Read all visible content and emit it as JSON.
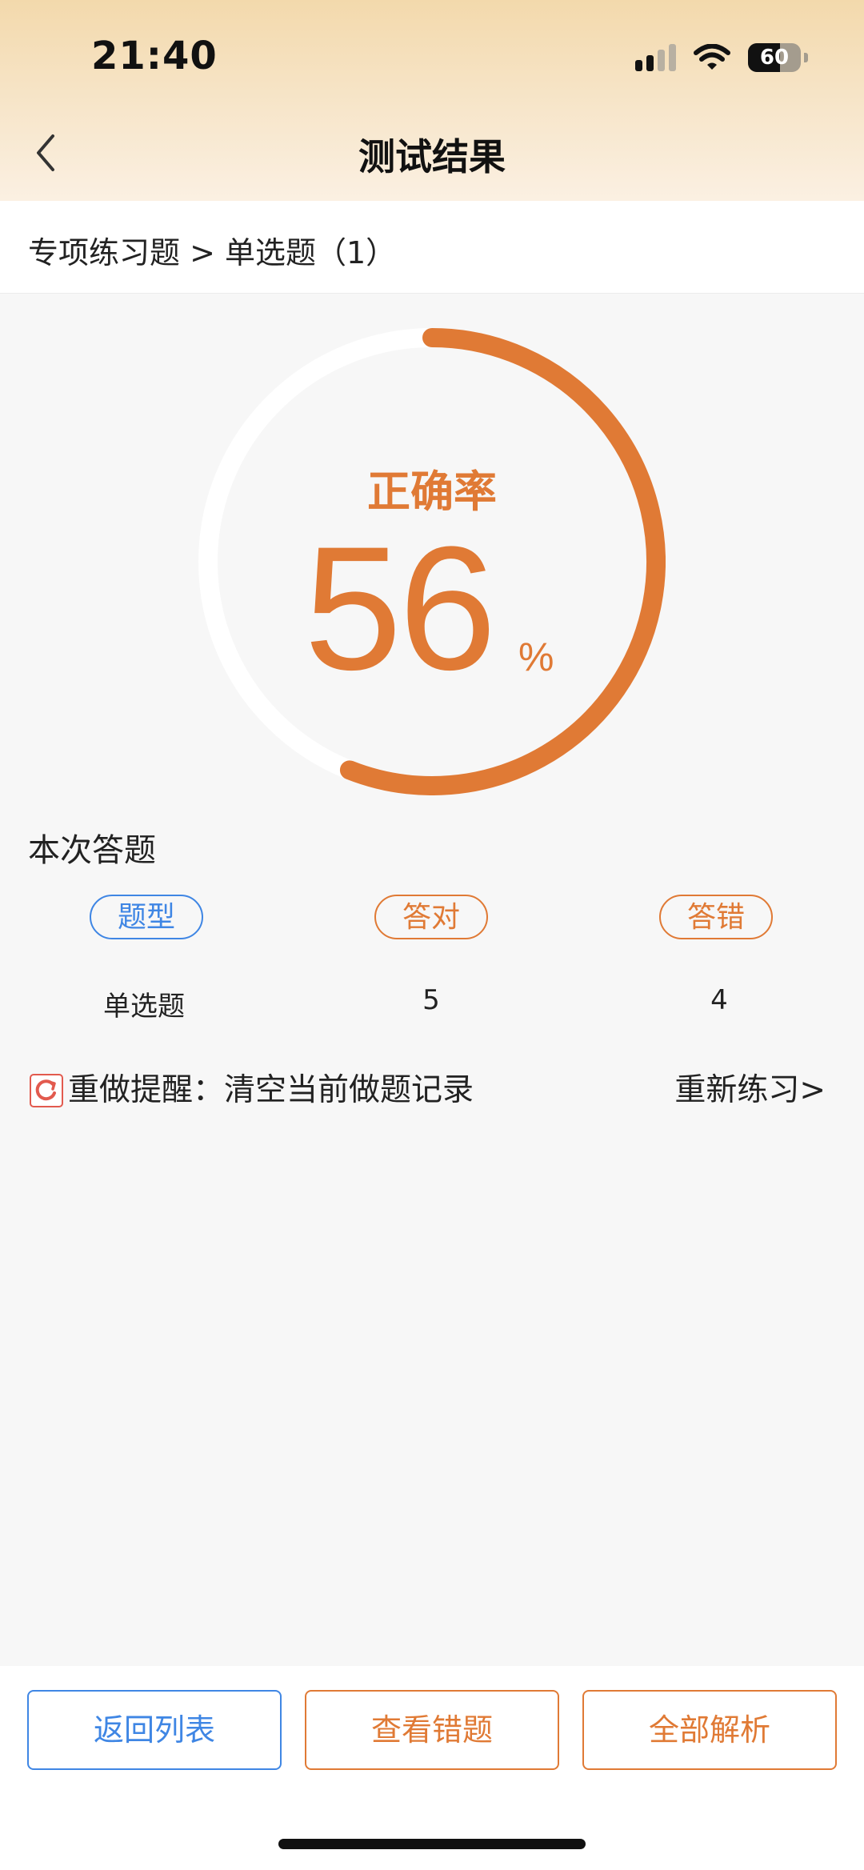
{
  "status_bar": {
    "time": "21:40",
    "battery": "60"
  },
  "header": {
    "title": "测试结果"
  },
  "breadcrumb": {
    "text": "专项练习题 > 单选题（1）"
  },
  "result": {
    "label": "正确率",
    "value": "56",
    "unit": "%",
    "progress_fraction": 0.56
  },
  "summary": {
    "title": "本次答题",
    "columns": [
      "题型",
      "答对",
      "答错"
    ],
    "row": [
      "单选题",
      "5",
      "4"
    ]
  },
  "reset": {
    "text": "重做提醒：清空当前做题记录",
    "link": "重新练习>"
  },
  "actions": {
    "back_list": "返回列表",
    "view_wrong": "查看错题",
    "all_analysis": "全部解析"
  },
  "colors": {
    "accent": "#e07a35",
    "blue": "#3f86e4",
    "track": "#ffffff",
    "warning_icon": "#e25a4e"
  },
  "icons": {
    "back": "chevron-left-icon",
    "reset": "refresh-icon"
  }
}
